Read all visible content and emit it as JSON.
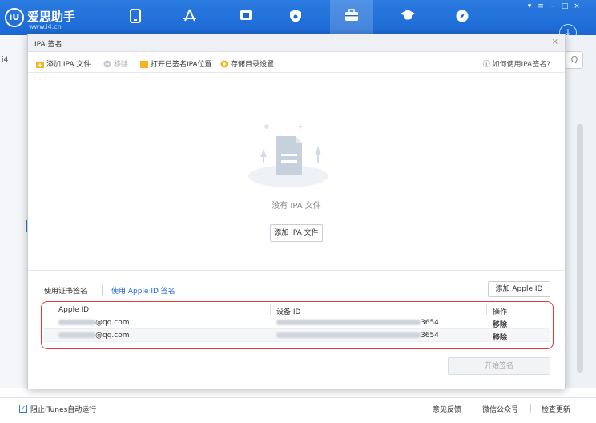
{
  "app": {
    "logo_glyph": "iU",
    "name": "爱思助手",
    "url": "www.i4.cn"
  },
  "nav": {
    "icons": [
      "device-icon",
      "apps-icon",
      "media-icon",
      "ringtone-icon",
      "toolbox-icon",
      "tutorial-icon",
      "browser-icon"
    ],
    "active_index": 4,
    "circle_button": "↓"
  },
  "window_controls": [
    "▾",
    "≡",
    "–",
    "□",
    "×"
  ],
  "background": {
    "left_label": "i4",
    "search_glyph": "Q"
  },
  "dialog": {
    "title": "IPA 签名",
    "close": "×",
    "toolbar": {
      "add_ipa": "添加 IPA 文件",
      "remove": "移除",
      "open_location": "打开已签名IPA位置",
      "storage_settings": "存储目录设置",
      "help": "如何使用IPA签名?"
    },
    "empty": {
      "text": "没有 IPA 文件",
      "button": "添加 IPA 文件"
    },
    "tabs": {
      "certificate": "使用证书签名",
      "apple_id": "使用 Apple ID 签名",
      "add_apple_id": "添加 Apple ID"
    },
    "table": {
      "headers": [
        "Apple ID",
        "设备 ID",
        "操作"
      ],
      "rows": [
        {
          "apple_id_suffix": "@qq.com",
          "device_suffix": "3654",
          "action": "移除"
        },
        {
          "apple_id_suffix": "@qq.com",
          "device_suffix": "3654",
          "action": "移除"
        }
      ]
    },
    "start_button": "开始签名"
  },
  "statusbar": {
    "checkbox_label": "阻止iTunes自动运行",
    "links": [
      "意见反馈",
      "微信公众号",
      "检查更新"
    ]
  },
  "colors": {
    "brand_blue": "#1b68d4",
    "highlight_red": "#e03a3a",
    "folder_yellow": "#f3b41d"
  }
}
